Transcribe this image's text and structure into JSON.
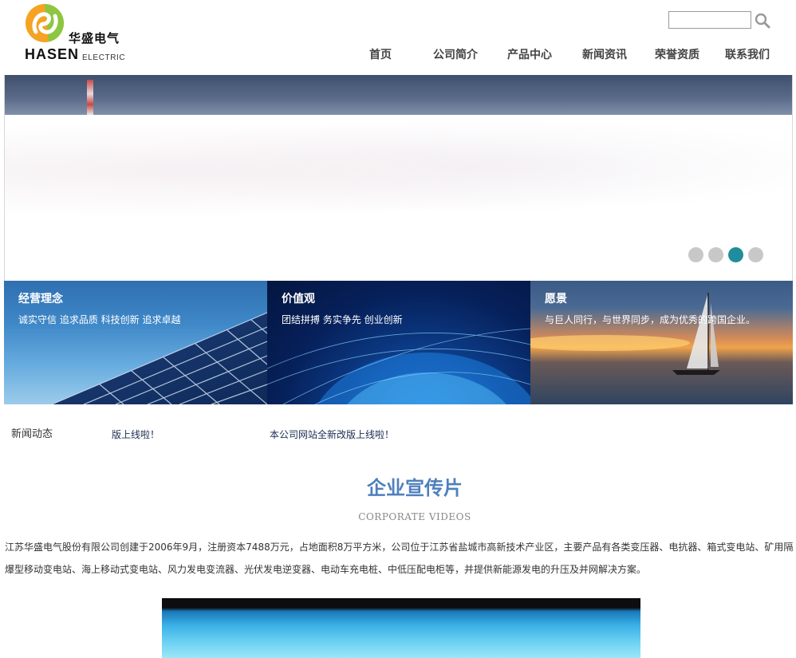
{
  "header": {
    "logo": {
      "cn": "华盛电气",
      "en": "HASEN",
      "sub": "ELECTRIC"
    },
    "search": {
      "value": "",
      "placeholder": ""
    },
    "nav": [
      {
        "label": "首页"
      },
      {
        "label": "公司简介"
      },
      {
        "label": "产品中心"
      },
      {
        "label": "新闻资讯"
      },
      {
        "label": "荣誉资质"
      },
      {
        "label": "联系我们"
      }
    ]
  },
  "banner": {
    "active_slide": 3,
    "slide_count": 4
  },
  "panels": [
    {
      "title": "经营理念",
      "text": "诚实守信  追求品质  科技创新  追求卓越"
    },
    {
      "title": "价值观",
      "text": "团结拼搏  务实争先  创业创新"
    },
    {
      "title": "愿景",
      "text": "与巨人同行，与世界同步，成为优秀的跨国企业。"
    }
  ],
  "news": {
    "label": "新闻动态",
    "items": [
      {
        "text": "版上线啦！"
      },
      {
        "text": "本公司网站全新改版上线啦！"
      }
    ]
  },
  "video_section": {
    "title": "企业宣传片",
    "subtitle": "CORPORATE VIDEOS",
    "intro": "江苏华盛电气股份有限公司创建于2006年9月，注册资本7488万元，占地面积8万平方米，公司位于江苏省盐城市高新技术产业区，主要产品有各类变压器、电抗器、箱式变电站、矿用隔爆型移动变电站、海上移动式变电站、风力发电变流器、光伏发电逆变器、电动车充电桩、中低压配电柜等，并提供新能源发电的升压及并网解决方案。"
  },
  "colors": {
    "accent": "#4f80bd",
    "dot_active": "#1f8d9b",
    "dot_inactive": "#c8c8c8",
    "news_link": "#1b2c53"
  }
}
